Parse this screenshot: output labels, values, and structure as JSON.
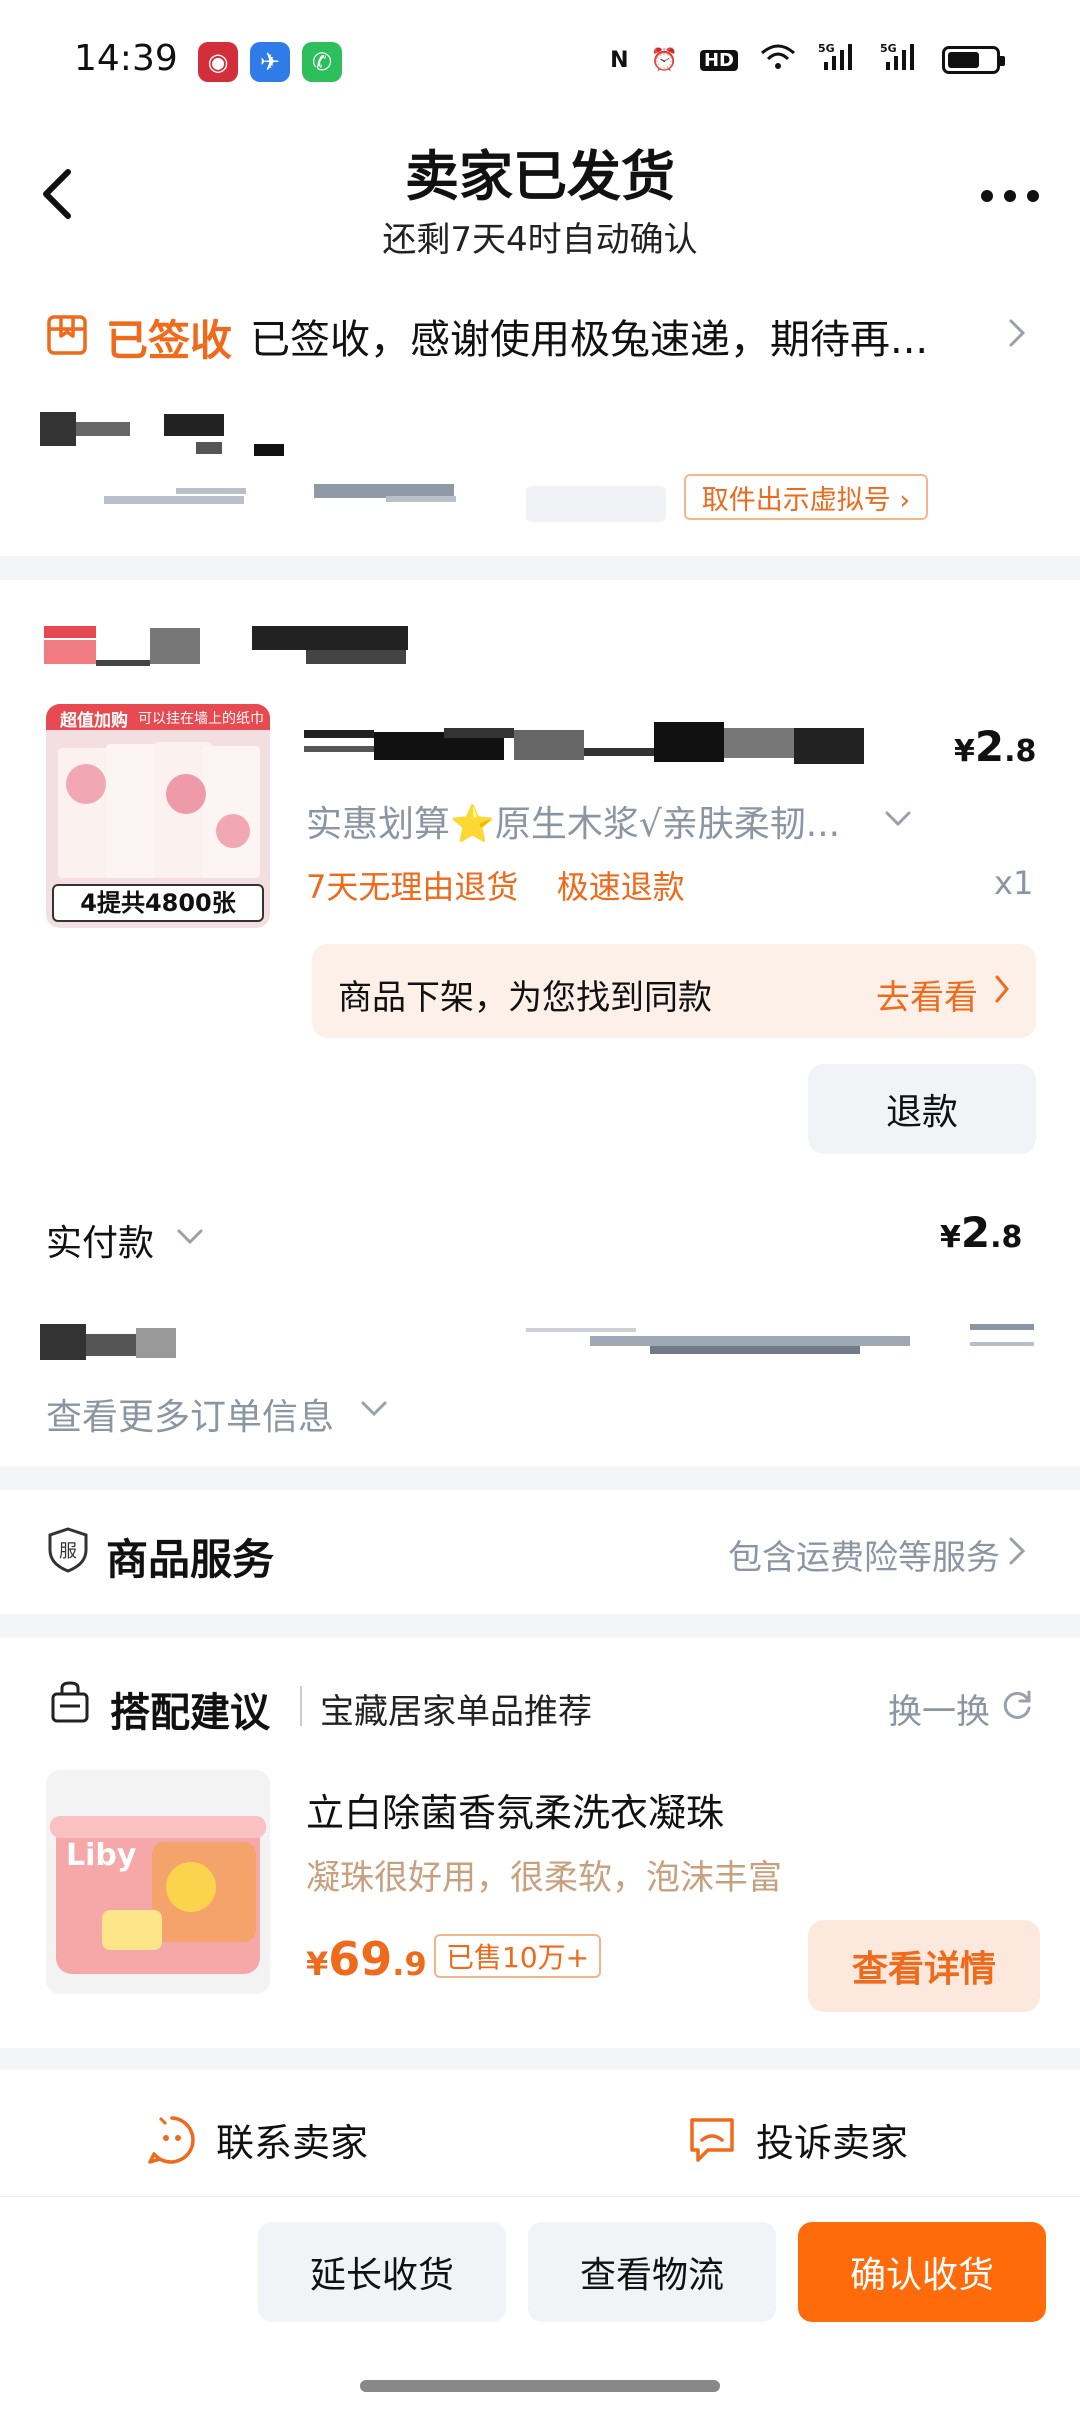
{
  "status_bar": {
    "time": "14:39",
    "network": "5G",
    "hd": "HD"
  },
  "header": {
    "title": "卖家已发货",
    "subtitle": "还剩7天4时自动确认"
  },
  "logistics": {
    "status": "已签收",
    "message": "已签收，感谢使用极兔速递，期待再...",
    "pickup_button": "取件出示虚拟号 ›"
  },
  "product": {
    "image_tag": "超值加购",
    "image_caption": "可以挂在墙上的纸巾",
    "image_bottom": "4提共4800张",
    "price": {
      "currency": "¥",
      "integer": "2",
      "decimal": ".8"
    },
    "spec": "实惠划算⭐原生木浆√亲肤柔韧...",
    "tags": [
      "7天无理由退货",
      "极速退款"
    ],
    "quantity": "x1",
    "offshelf_text": "商品下架，为您找到同款",
    "offshelf_link": "去看看",
    "refund_button": "退款"
  },
  "payment": {
    "label": "实付款",
    "currency": "¥",
    "integer": "2",
    "decimal": ".8"
  },
  "order": {
    "more_info": "查看更多订单信息"
  },
  "services": {
    "icon_text": "服",
    "title": "商品服务",
    "summary": "包含运费险等服务"
  },
  "recommend": {
    "title": "搭配建议",
    "subtitle": "宝藏居家单品推荐",
    "swap": "换一换",
    "item": {
      "brand": "Liby",
      "name": "立白除菌香氛柔洗衣凝珠",
      "desc": "凝珠很好用，很柔软，泡沫丰富",
      "price": {
        "currency": "¥",
        "integer": "69",
        "decimal": ".9"
      },
      "sold": "已售10万+",
      "detail_button": "查看详情"
    }
  },
  "contact": {
    "seller": "联系卖家",
    "complain": "投诉卖家"
  },
  "actions": {
    "extend": "延长收货",
    "logistics": "查看物流",
    "confirm": "确认收货"
  },
  "colors": {
    "accent": "#ef6a1a",
    "confirm": "#ff6a0a",
    "grey": "#8c95a3"
  }
}
